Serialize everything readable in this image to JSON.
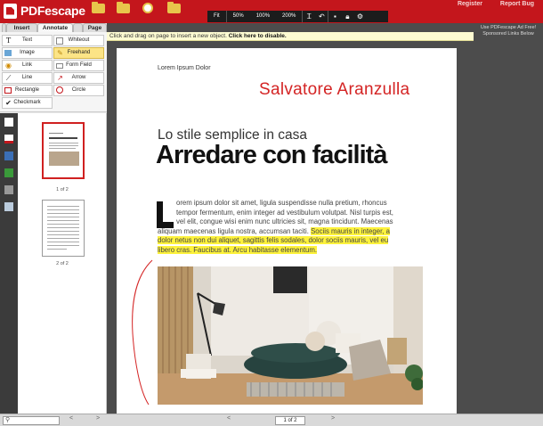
{
  "app": {
    "brand": "PDFescape"
  },
  "topbar": {
    "register": "Register",
    "report_bug": "Report Bug"
  },
  "zoom": {
    "fit": "Fit",
    "z50": "50%",
    "z100": "100%",
    "z200": "200%"
  },
  "notice": {
    "text": "Click and drag on page to insert a new object.",
    "link": "Click here to disable."
  },
  "ad": {
    "text": "Use PDFescape Ad Free! Sponsored Links Below"
  },
  "tabs": [
    {
      "label": "Insert"
    },
    {
      "label": "Annotate"
    },
    {
      "label": "Page"
    }
  ],
  "tools": {
    "text": "Text",
    "whiteout": "Whiteout",
    "image": "Image",
    "freehand": "Freehand",
    "link": "Link",
    "form_field": "Form Field",
    "line": "Line",
    "arrow": "Arrow",
    "rectangle": "Rectangle",
    "circle": "Circle",
    "checkmark": "Checkmark"
  },
  "thumbnails": [
    {
      "label": "1 of 2",
      "active": true
    },
    {
      "label": "2 of 2",
      "active": false
    }
  ],
  "document": {
    "header": "Lorem Ipsum Dolor",
    "signature_text": "Salvatore Aranzulla",
    "subtitle": "Lo stile semplice in casa",
    "title": "Arredare con facilità",
    "body_lines": [
      "orem ipsum dolor sit amet, ligula suspendisse nulla pretium, rhoncus",
      "tempor fermentum, enim integer ad vestibulum volutpat. Nisl turpis est,",
      "vel elit, congue wisi enim nunc ultricies sit, magna tincidunt. Maecenas",
      "aliquam maecenas ligula nostra, accumsan taciti."
    ],
    "highlighted_lines": [
      "Sociis mauris in integer, a",
      "dolor netus non dui aliquet, sagittis felis sodales, dolor sociis mauris, vel eu",
      "libero cras. Faucibus at. Arcu habitasse elementum."
    ]
  },
  "bottom": {
    "page_selector": "1 of 2"
  },
  "colors": {
    "brand_red": "#c4161c",
    "highlight": "#fdf23c",
    "active_tool": "#fce486"
  }
}
